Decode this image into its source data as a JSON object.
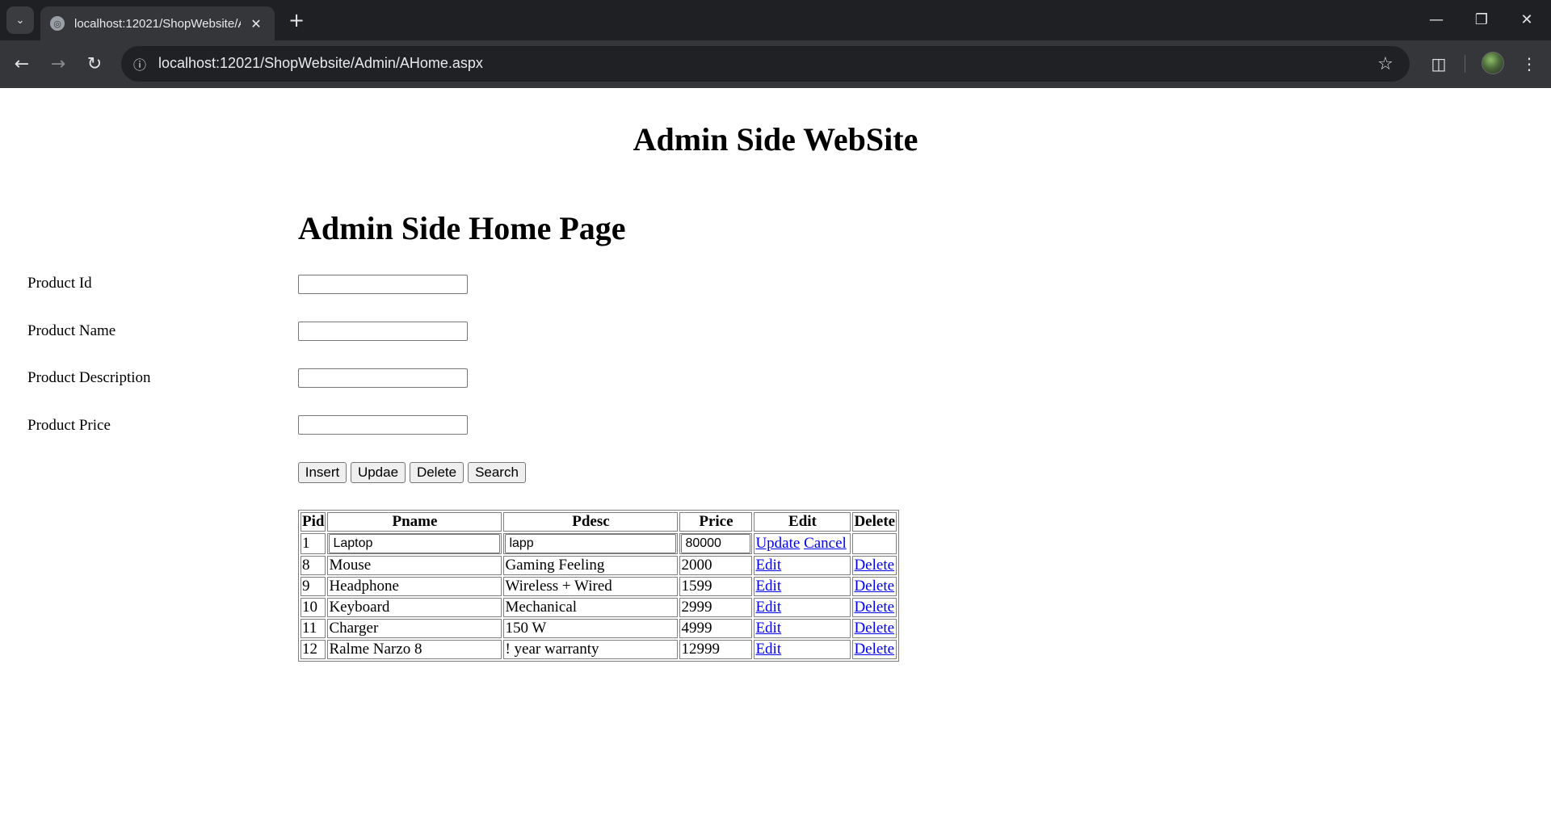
{
  "browser": {
    "tab_title": "localhost:12021/ShopWebsite/Admin/AHome.aspx",
    "url": "localhost:12021/ShopWebsite/Admin/AHome.aspx",
    "icons": {
      "tab_search": "chevron-down-icon",
      "favicon": "globe-icon",
      "tab_close": "close-icon",
      "new_tab": "plus-icon",
      "back": "arrow-left-icon",
      "forward": "arrow-right-icon",
      "reload": "reload-icon",
      "site_info": "info-icon",
      "bookmark": "star-icon",
      "extensions": "puzzle-icon",
      "profile": "avatar",
      "menu": "kebab-menu-icon",
      "minimize": "minimize-icon",
      "restore": "restore-icon",
      "close_window": "close-icon"
    }
  },
  "page": {
    "site_title": "Admin Side WebSite",
    "heading": "Admin Side Home Page",
    "form": {
      "fields": [
        {
          "label": "Product Id",
          "value": ""
        },
        {
          "label": "Product Name",
          "value": ""
        },
        {
          "label": "Product Description",
          "value": ""
        },
        {
          "label": "Product Price",
          "value": ""
        }
      ]
    },
    "buttons": {
      "insert": "Insert",
      "update": "Updae",
      "delete": "Delete",
      "search": "Search"
    },
    "grid": {
      "headers": [
        "Pid",
        "Pname",
        "Pdesc",
        "Price",
        "Edit",
        "Delete"
      ],
      "edit_row": {
        "pid": "1",
        "pname": "Laptop",
        "pdesc": "lapp",
        "price": "80000",
        "update_link": "Update",
        "cancel_link": "Cancel"
      },
      "rows": [
        {
          "pid": "8",
          "pname": "Mouse",
          "pdesc": "Gaming Feeling",
          "price": "2000",
          "edit": "Edit",
          "delete": "Delete"
        },
        {
          "pid": "9",
          "pname": "Headphone",
          "pdesc": "Wireless + Wired",
          "price": "1599",
          "edit": "Edit",
          "delete": "Delete"
        },
        {
          "pid": "10",
          "pname": "Keyboard",
          "pdesc": "Mechanical",
          "price": "2999",
          "edit": "Edit",
          "delete": "Delete"
        },
        {
          "pid": "11",
          "pname": "Charger",
          "pdesc": "150 W",
          "price": "4999",
          "edit": "Edit",
          "delete": "Delete"
        },
        {
          "pid": "12",
          "pname": "Ralme Narzo 8",
          "pdesc": "! year warranty",
          "price": "12999",
          "edit": "Edit",
          "delete": "Delete"
        }
      ]
    }
  }
}
